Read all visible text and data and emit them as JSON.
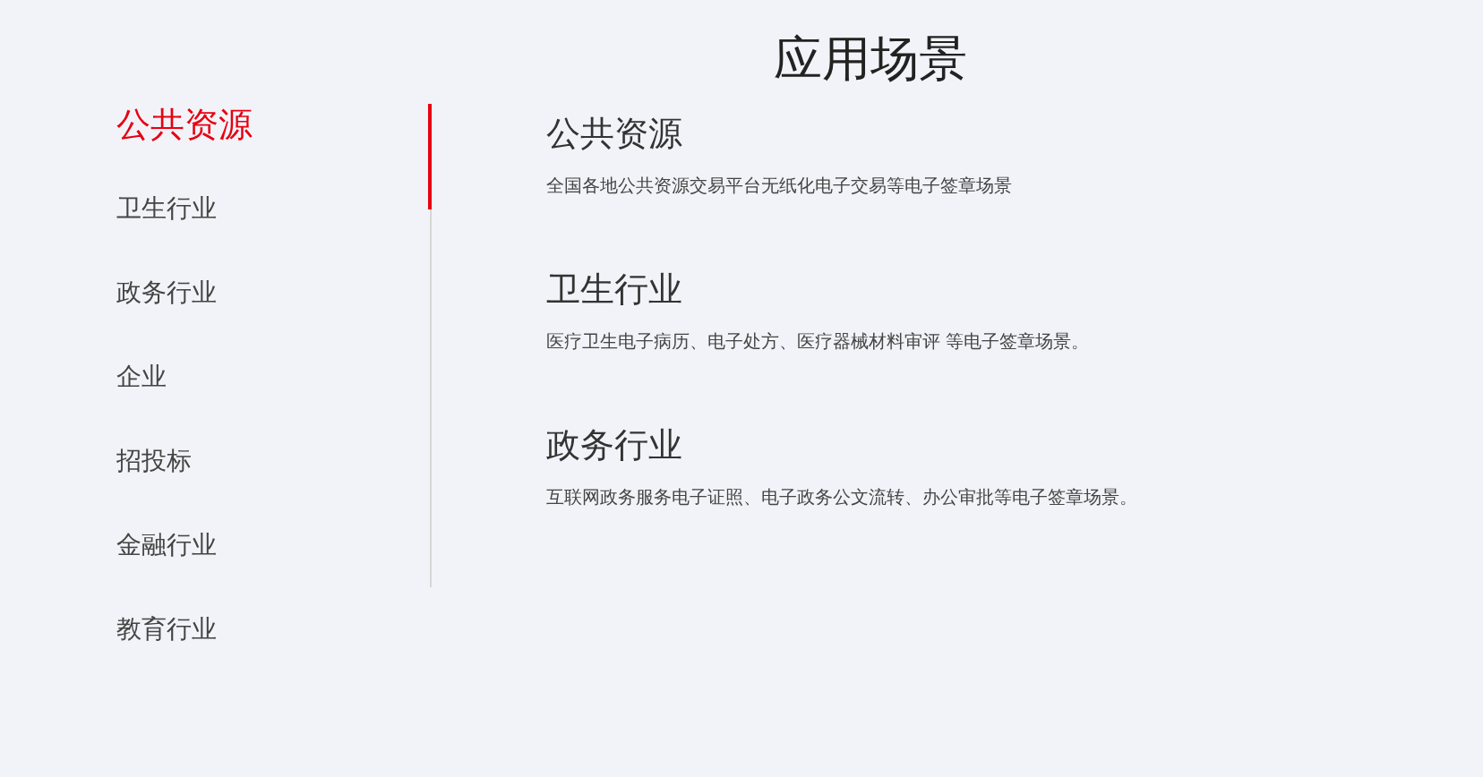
{
  "title": "应用场景",
  "sidebar": {
    "items": [
      {
        "label": "公共资源",
        "selected": true
      },
      {
        "label": "卫生行业",
        "selected": false
      },
      {
        "label": "政务行业",
        "selected": false
      },
      {
        "label": "企业",
        "selected": false
      },
      {
        "label": "招投标",
        "selected": false
      },
      {
        "label": "金融行业",
        "selected": false
      },
      {
        "label": "教育行业",
        "selected": false
      }
    ]
  },
  "sections": [
    {
      "heading": "公共资源",
      "description": "全国各地公共资源交易平台无纸化电子交易等电子签章场景"
    },
    {
      "heading": "卫生行业",
      "description": "医疗卫生电子病历、电子处方、医疗器械材料审评 等电子签章场景。"
    },
    {
      "heading": "政务行业",
      "description": "互联网政务服务电子证照、电子政务公文流转、办公审批等电子签章场景。"
    }
  ]
}
